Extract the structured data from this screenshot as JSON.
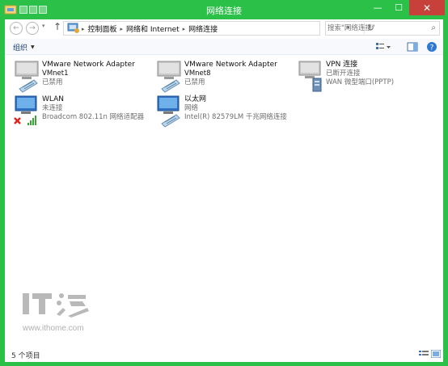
{
  "window": {
    "title": "网络连接",
    "minimize_glyph": "—",
    "maximize_glyph": "☐",
    "close_glyph": "✕"
  },
  "navigation": {
    "back_glyph": "←",
    "forward_glyph": "→",
    "recent_glyph": "▾",
    "up_glyph": "↑",
    "breadcrumbs": [
      "控制面板",
      "网络和 Internet",
      "网络连接"
    ],
    "separator": "▸",
    "dropdown_glyph": "▾",
    "refresh_glyph": "↻"
  },
  "search": {
    "placeholder": "搜索\"网络连接\"",
    "icon_glyph": "⌕"
  },
  "toolbar": {
    "organize_label": "组织",
    "organize_caret": "▼"
  },
  "connections": [
    {
      "name": "VMware Network Adapter",
      "line1": "VMnet1",
      "line2": "已禁用",
      "icon": "network-adapter-disabled-icon"
    },
    {
      "name": "VMware Network Adapter",
      "line1": "VMnet8",
      "line2": "已禁用",
      "icon": "network-adapter-disabled-icon"
    },
    {
      "name": "VPN 连接",
      "line1": "已断开连接",
      "line2": "WAN 微型端口(PPTP)",
      "icon": "vpn-connection-icon"
    },
    {
      "name": "WLAN",
      "line1": "未连接",
      "line2": "Broadcom 802.11n 网络适配器",
      "icon": "wlan-adapter-icon"
    },
    {
      "name": "以太网",
      "line1": "网络",
      "line2": "Intel(R) 82579LM 千兆网络连接",
      "icon": "ethernet-adapter-icon"
    }
  ],
  "watermark": {
    "logo_text": "IT之家",
    "url": "www.ithome.com"
  },
  "status": {
    "item_count": "5 个项目"
  },
  "colors": {
    "frame": "#2bc048",
    "close_button": "#c7403a",
    "link_text": "#1e3d78",
    "error_x": "#d8261c",
    "signal_green": "#3aa335"
  }
}
